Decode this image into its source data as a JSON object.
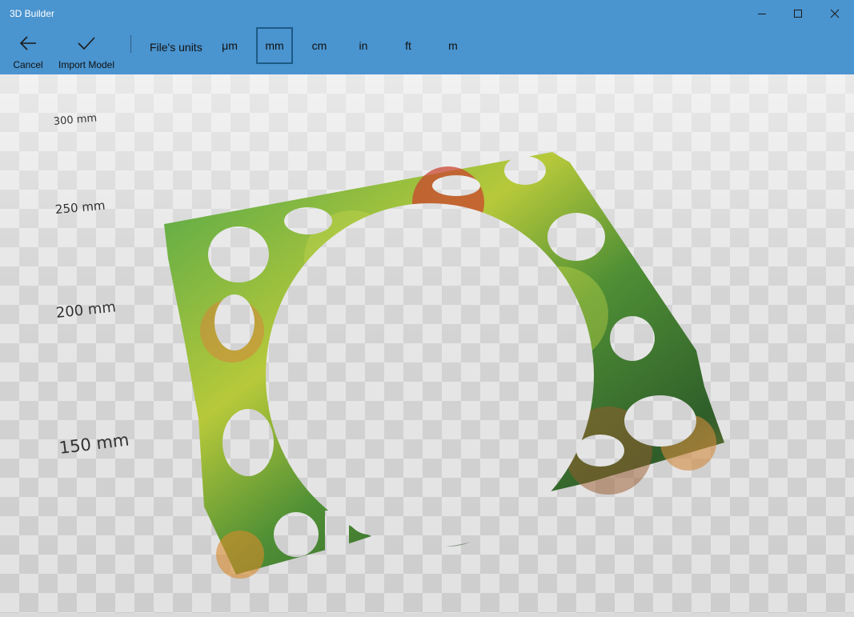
{
  "window": {
    "title": "3D Builder"
  },
  "toolbar": {
    "cancel_label": "Cancel",
    "import_label": "Import Model",
    "units_label": "File's units",
    "units": [
      "μm",
      "mm",
      "cm",
      "in",
      "ft",
      "m"
    ],
    "selected_unit": "mm"
  },
  "scale_labels": [
    "300 mm",
    "250 mm",
    "200 mm",
    "150 mm"
  ],
  "colors": {
    "accent": "#4a94cf",
    "selected_border": "#1c5a86"
  },
  "icons": {
    "back": "arrow-left-icon",
    "import": "checkmark-icon",
    "minimize": "minimize-icon",
    "maximize": "maximize-icon",
    "close": "close-icon"
  }
}
